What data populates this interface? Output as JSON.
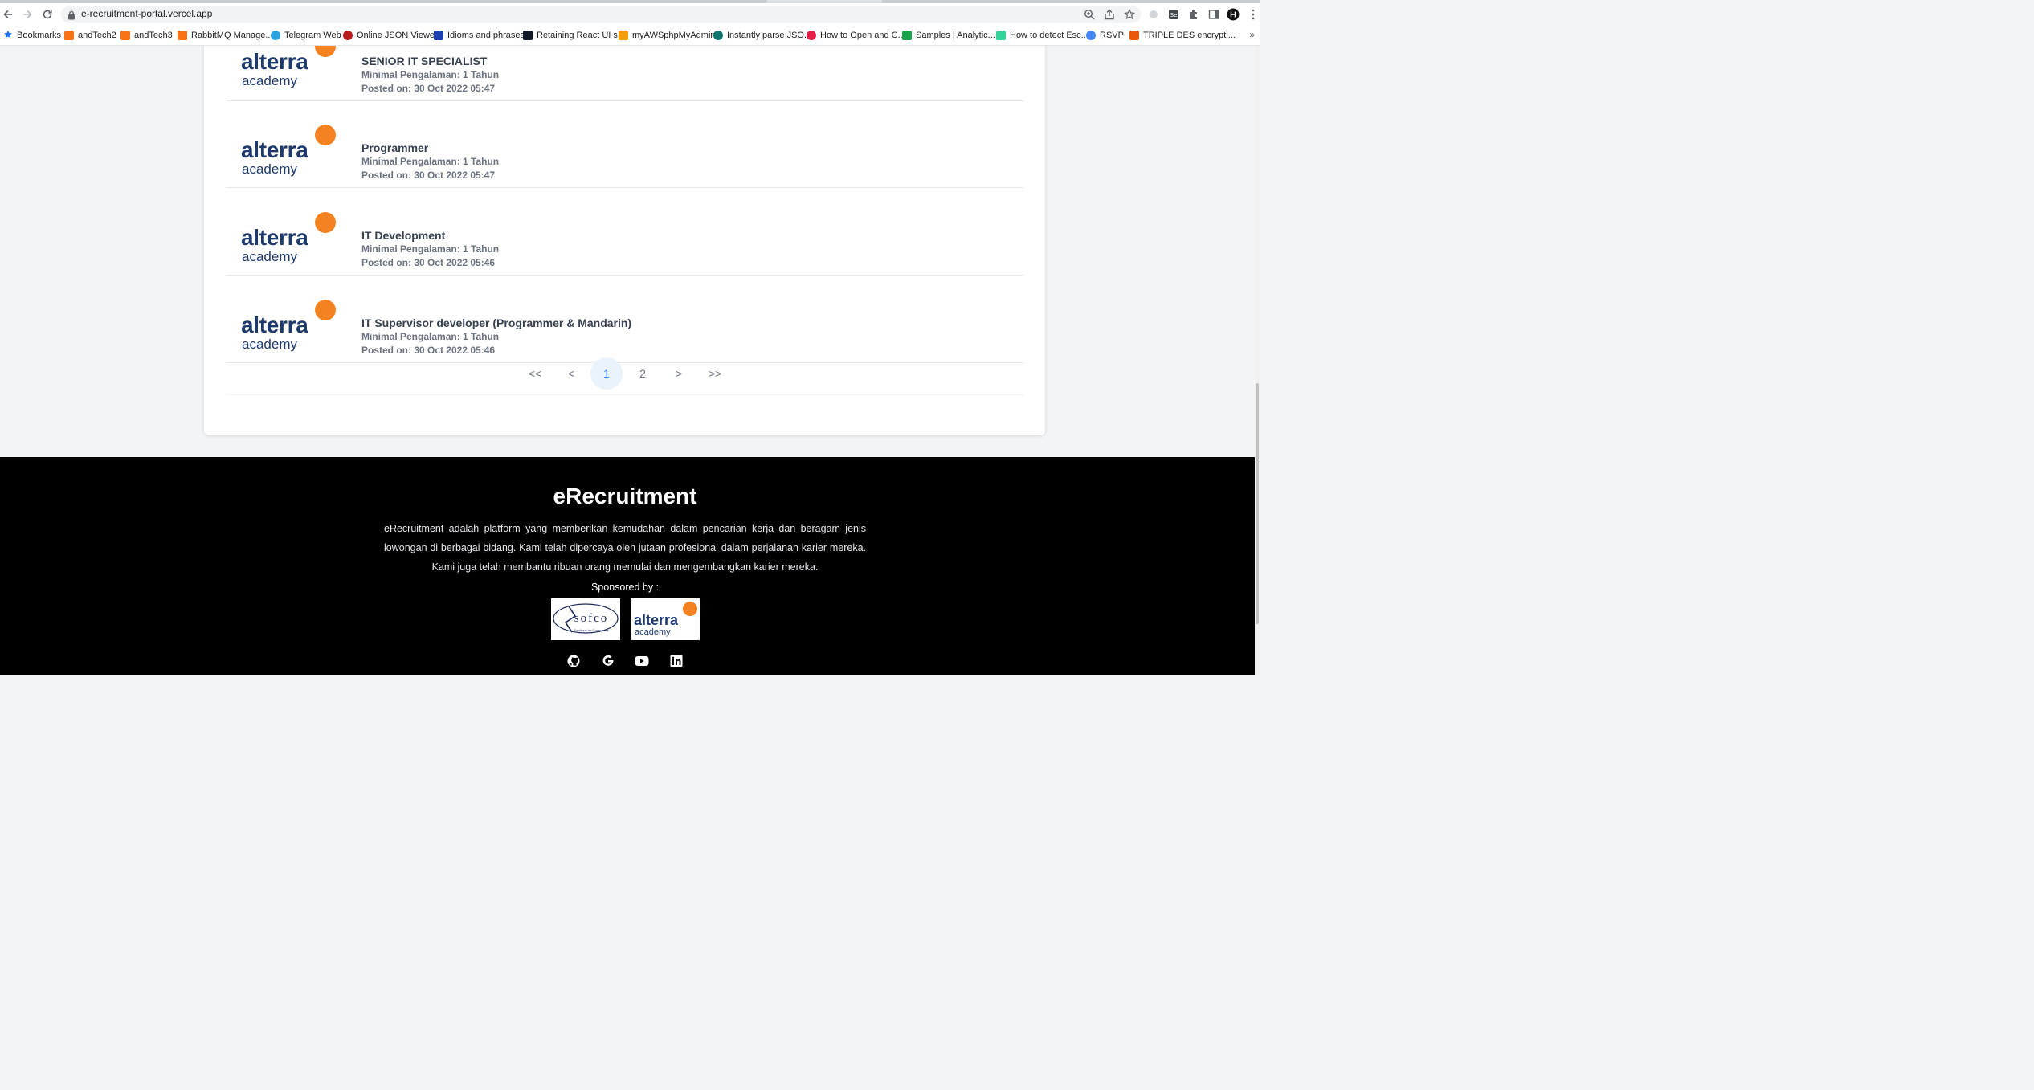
{
  "browser": {
    "url": "e-recruitment-portal.vercel.app",
    "bookmarks": [
      {
        "label": "Bookmarks",
        "color": "#1a73e8"
      },
      {
        "label": "andTech2",
        "color": "#f97316"
      },
      {
        "label": "andTech3",
        "color": "#f97316"
      },
      {
        "label": "RabbitMQ Manage...",
        "color": "#f97316"
      },
      {
        "label": "Telegram Web",
        "color": "#2aa3e0"
      },
      {
        "label": "Online JSON Viewer",
        "color": "#b91c1c"
      },
      {
        "label": "Idioms and phrases",
        "color": "#1e40af"
      },
      {
        "label": "Retaining React UI s...",
        "color": "#111827"
      },
      {
        "label": "myAWSphpMyAdmin",
        "color": "#f59e0b"
      },
      {
        "label": "Instantly parse JSO...",
        "color": "#0f766e"
      },
      {
        "label": "How to Open and C...",
        "color": "#e11d48"
      },
      {
        "label": "Samples | Analytic...",
        "color": "#16a34a"
      },
      {
        "label": "How to detect Esc...",
        "color": "#34d399"
      },
      {
        "label": "RSVP",
        "color": "#4285f4"
      },
      {
        "label": "TRIPLE DES encrypti...",
        "color": "#ea580c"
      }
    ]
  },
  "jobs": [
    {
      "title": "SENIOR IT SPECIALIST",
      "experience": "Minimal Pengalaman: 1 Tahun",
      "posted": "Posted on: 30 Oct 2022 05:47"
    },
    {
      "title": "Programmer",
      "experience": "Minimal Pengalaman: 1 Tahun",
      "posted": "Posted on: 30 Oct 2022 05:47"
    },
    {
      "title": "IT Development",
      "experience": "Minimal Pengalaman: 1 Tahun",
      "posted": "Posted on: 30 Oct 2022 05:46"
    },
    {
      "title": "IT Supervisor developer (Programmer & Mandarin)",
      "experience": "Minimal Pengalaman: 1 Tahun",
      "posted": "Posted on: 30 Oct 2022 05:46"
    }
  ],
  "logo": {
    "brand": "alterra",
    "sub": "academy"
  },
  "pagination": {
    "first": "<<",
    "prev": "<",
    "pages": [
      "1",
      "2"
    ],
    "current": "1",
    "next": ">",
    "last": ">>"
  },
  "footer": {
    "title": "eRecruitment",
    "description": "eRecruitment adalah platform yang memberikan kemudahan dalam pencarian kerja dan beragam jenis lowongan di berbagai bidang. Kami telah dipercaya oleh jutaan profesional dalam perjalanan karier mereka. Kami juga telah membantu ribuan orang memulai dan mengembangkan karier mereka.",
    "sponsored_label": "Sponsored by :",
    "sponsors": [
      {
        "name": "sofco",
        "tagline": "Solutions for Companies"
      },
      {
        "name": "alterra",
        "tagline": "academy"
      }
    ]
  },
  "colors": {
    "brand_navy": "#1e3a6d",
    "brand_orange": "#f58220",
    "active_page": "#3b82f6"
  }
}
